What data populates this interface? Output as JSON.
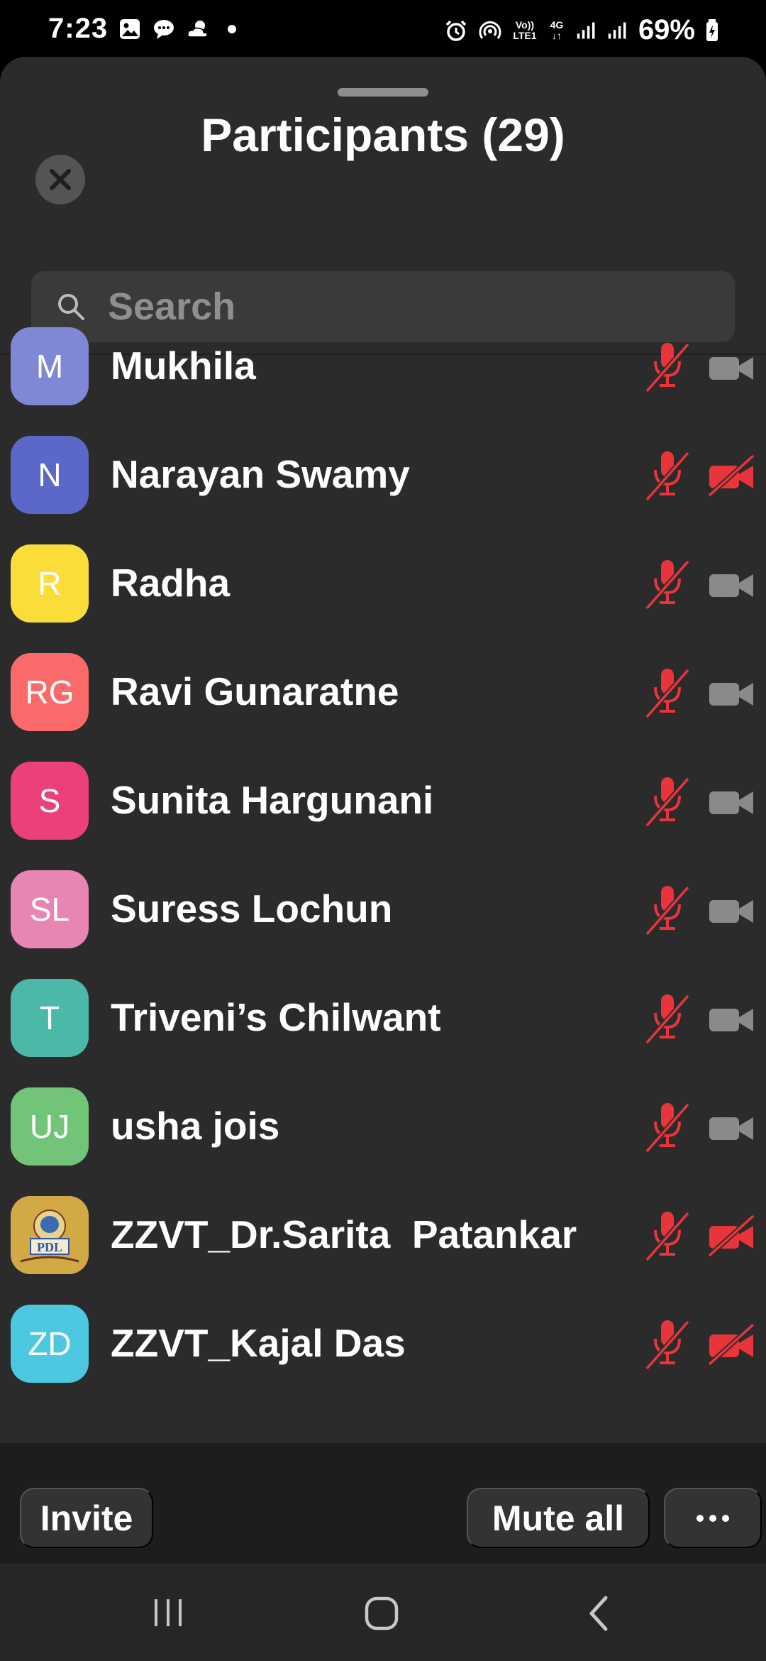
{
  "status_bar": {
    "time": "7:23",
    "left_icons": [
      "gallery-icon",
      "chat-bubble-icon",
      "weather-icon",
      "dot-icon"
    ],
    "volte_label": "Vo))",
    "lte_label": "LTE1",
    "network_label": "4G",
    "battery_percent": "69%"
  },
  "sheet": {
    "title": "Participants (29)"
  },
  "search": {
    "placeholder": "Search",
    "value": ""
  },
  "participants": [
    {
      "initials": "M",
      "name": "Mukhila",
      "avatar_color": "#7f88d4",
      "mic_muted": true,
      "camera_off": false
    },
    {
      "initials": "N",
      "name": "Narayan Swamy",
      "avatar_color": "#5c68c8",
      "mic_muted": true,
      "camera_off": true
    },
    {
      "initials": "R",
      "name": "Radha",
      "avatar_color": "#fbdd3a",
      "mic_muted": true,
      "camera_off": false
    },
    {
      "initials": "RG",
      "name": "Ravi Gunaratne",
      "avatar_color": "#fb6a6a",
      "mic_muted": true,
      "camera_off": false
    },
    {
      "initials": "S",
      "name": "Sunita Hargunani",
      "avatar_color": "#ec4078",
      "mic_muted": true,
      "camera_off": false
    },
    {
      "initials": "SL",
      "name": "Suress Lochun",
      "avatar_color": "#e785b5",
      "mic_muted": true,
      "camera_off": false
    },
    {
      "initials": "T",
      "name": "Triveni’s Chilwant",
      "avatar_color": "#4cb8a8",
      "mic_muted": true,
      "camera_off": false
    },
    {
      "initials": "UJ",
      "name": "usha jois",
      "avatar_color": "#72c479",
      "mic_muted": true,
      "camera_off": false
    },
    {
      "initials": "",
      "name": "ZZVT_Dr.Sarita  Patankar",
      "avatar_color": "#c7a23a",
      "avatar_image": "pdl-logo-photo",
      "avatar_image_text": "PDL",
      "mic_muted": true,
      "camera_off": true
    },
    {
      "initials": "ZD",
      "name": "ZZVT_Kajal Das",
      "avatar_color": "#4cc9e0",
      "mic_muted": true,
      "camera_off": true
    }
  ],
  "actions": {
    "invite_label": "Invite",
    "mute_all_label": "Mute all",
    "more_label": "···"
  },
  "nav_bar": {
    "icons": [
      "recent-apps-icon",
      "home-icon",
      "back-icon"
    ]
  },
  "colors": {
    "sheet_bg": "#2b2b2b",
    "muted_red": "#e8353b",
    "camera_gray": "#8a8a8a"
  }
}
